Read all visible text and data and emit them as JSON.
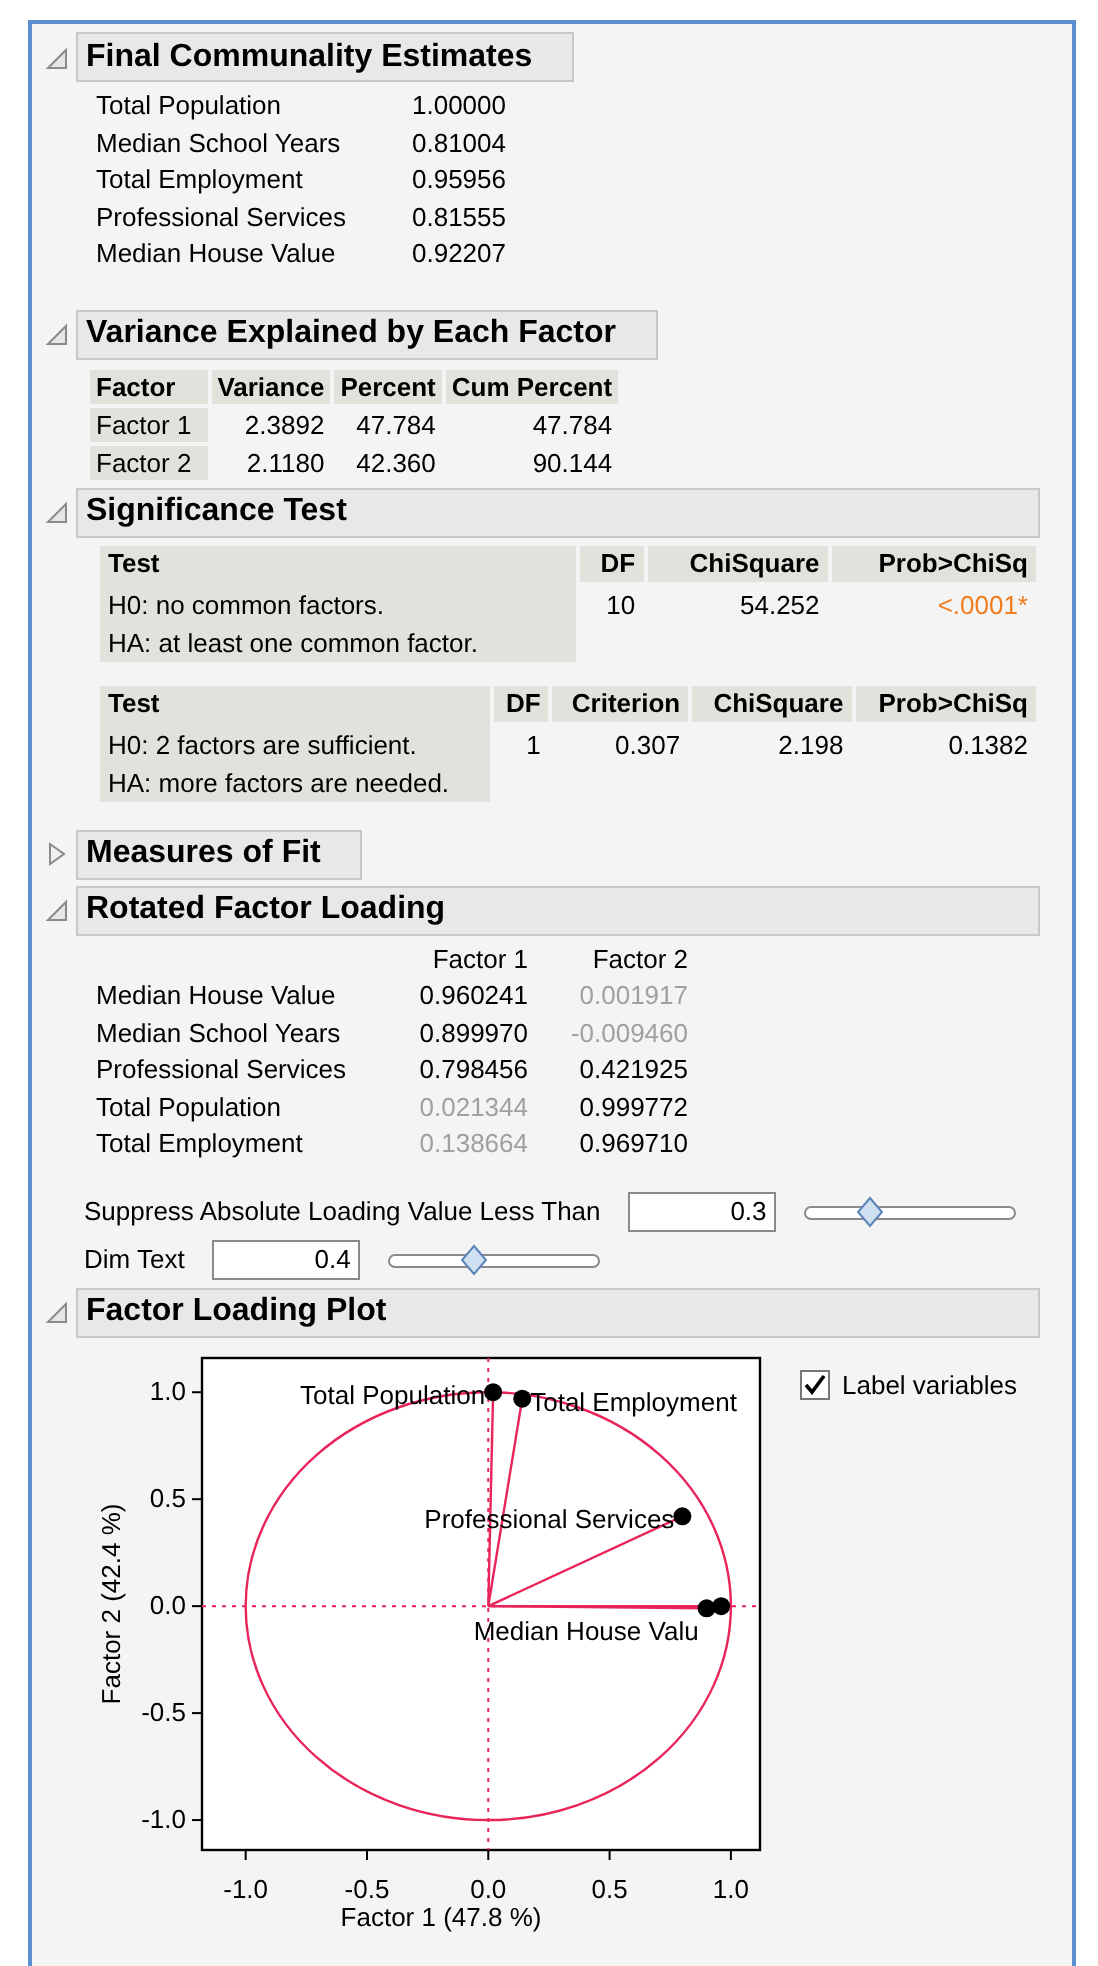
{
  "sections": [
    {
      "kind": "estimates",
      "title": "Final Communality Estimates",
      "expanded": true,
      "rows": [
        {
          "label": "Total Population",
          "value": "1.00000"
        },
        {
          "label": "Median School Years",
          "value": "0.81004"
        },
        {
          "label": "Total Employment",
          "value": "0.95956"
        },
        {
          "label": "Professional Services",
          "value": "0.81555"
        },
        {
          "label": "Median House Value",
          "value": "0.92207"
        }
      ]
    },
    {
      "kind": "table",
      "title": "Variance Explained by Each Factor",
      "expanded": true,
      "columns": [
        "Factor",
        "Variance",
        "Percent",
        "Cum Percent"
      ],
      "rows": [
        [
          "Factor 1",
          "2.3892",
          "47.784",
          "47.784"
        ],
        [
          "Factor 2",
          "2.1180",
          "42.360",
          "90.144"
        ]
      ]
    },
    {
      "kind": "tests",
      "title": "Significance Test",
      "expanded": true,
      "tables": [
        {
          "columns": [
            "Test",
            "DF",
            "ChiSquare",
            "Prob>ChiSq"
          ],
          "rows": [
            {
              "cells": [
                {
                  "lines": [
                    "H0: no common factors.",
                    "HA: at least one common factor."
                  ]
                },
                {
                  "text": "10",
                  "significant": false
                },
                {
                  "text": "54.252",
                  "significant": false
                },
                {
                  "text": "<.0001*",
                  "significant": true
                }
              ]
            }
          ]
        },
        {
          "columns": [
            "Test",
            "DF",
            "Criterion",
            "ChiSquare",
            "Prob>ChiSq"
          ],
          "rows": [
            {
              "cells": [
                {
                  "lines": [
                    "H0: 2 factors are sufficient.",
                    "HA: more factors are needed."
                  ]
                },
                {
                  "text": "1",
                  "significant": false
                },
                {
                  "text": "0.307",
                  "significant": false
                },
                {
                  "text": "2.198",
                  "significant": false
                },
                {
                  "text": "0.1382",
                  "significant": false
                }
              ]
            }
          ]
        }
      ]
    },
    {
      "kind": "collapsed",
      "title": "Measures of Fit",
      "expanded": false
    },
    {
      "kind": "loadings",
      "title": "Rotated Factor Loading",
      "expanded": true,
      "columns": [
        "Factor 1",
        "Factor 2"
      ],
      "rows": [
        {
          "label": "Median House Value",
          "values": [
            {
              "text": "0.960241",
              "dim": false
            },
            {
              "text": "0.001917",
              "dim": true
            }
          ]
        },
        {
          "label": "Median School Years",
          "values": [
            {
              "text": "0.899970",
              "dim": false
            },
            {
              "text": "-0.009460",
              "dim": true
            }
          ]
        },
        {
          "label": "Professional Services",
          "values": [
            {
              "text": "0.798456",
              "dim": false
            },
            {
              "text": "0.421925",
              "dim": false
            }
          ]
        },
        {
          "label": "Total Population",
          "values": [
            {
              "text": "0.021344",
              "dim": true
            },
            {
              "text": "0.999772",
              "dim": false
            }
          ]
        },
        {
          "label": "Total Employment",
          "values": [
            {
              "text": "0.138664",
              "dim": true
            },
            {
              "text": "0.969710",
              "dim": false
            }
          ]
        }
      ],
      "controls": [
        {
          "label": "Suppress Absolute Loading Value Less Than",
          "value": "0.3",
          "level": 0.31
        },
        {
          "label": "Dim Text",
          "value": "0.4",
          "level": 0.4
        }
      ]
    },
    {
      "kind": "plot",
      "title": "Factor Loading Plot",
      "expanded": true,
      "checkbox": {
        "label": "Label variables",
        "checked": true
      },
      "chart_data": {
        "type": "scatter",
        "xlabel": "Factor 1  (47.8 %)",
        "ylabel": "Factor 2  (42.4 %)",
        "xlim": [
          -1.18,
          1.12
        ],
        "ylim": [
          -1.14,
          1.16
        ],
        "xticks": [
          {
            "value": -1,
            "label": "-1.0"
          },
          {
            "value": -0.5,
            "label": "-0.5"
          },
          {
            "value": 0,
            "label": "0.0"
          },
          {
            "value": 0.5,
            "label": "0.5"
          },
          {
            "value": 1,
            "label": "1.0"
          }
        ],
        "yticks": [
          {
            "value": -1,
            "label": "-1.0"
          },
          {
            "value": -0.5,
            "label": "-0.5"
          },
          {
            "value": 0,
            "label": "0.0"
          },
          {
            "value": 0.5,
            "label": "0.5"
          },
          {
            "value": 1,
            "label": "1.0"
          }
        ],
        "series": [
          {
            "color": "#000000",
            "x": [
              0.96,
              0.9,
              0.8,
              0.02,
              0.14
            ],
            "values": [
              0.0,
              -0.01,
              0.42,
              1.0,
              0.97
            ]
          }
        ],
        "annotations": [
          {
            "text": "Total Population",
            "x": 0.02,
            "y": 1.0
          },
          {
            "text": "Total Employment",
            "x": 0.14,
            "y": 0.97
          },
          {
            "text": "Professional Services",
            "x": 0.8,
            "y": 0.42
          },
          {
            "text": "Median House Valu",
            "x": 0.9,
            "y": -0.01
          }
        ]
      }
    }
  ]
}
